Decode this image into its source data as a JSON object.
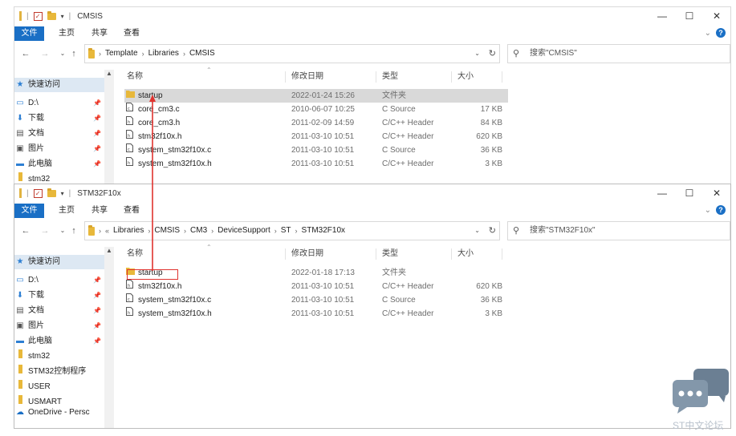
{
  "windows": [
    {
      "title": "CMSIS",
      "ribbon_tabs": [
        "文件",
        "主页",
        "共享",
        "查看"
      ],
      "breadcrumb": [
        "Template",
        "Libraries",
        "CMSIS"
      ],
      "breadcrumb_prefix": "",
      "search_placeholder": "搜索\"CMSIS\"",
      "columns": [
        "名称",
        "修改日期",
        "类型",
        "大小"
      ],
      "files": [
        {
          "name": "startup",
          "date": "2022-01-24 15:26",
          "type": "文件夹",
          "size": "",
          "icon": "folder-icon",
          "selected": true
        },
        {
          "name": "core_cm3.c",
          "date": "2010-06-07 10:25",
          "type": "C Source",
          "size": "17 KB",
          "icon": "c-source-file-icon",
          "selected": false
        },
        {
          "name": "core_cm3.h",
          "date": "2011-02-09 14:59",
          "type": "C/C++ Header",
          "size": "84 KB",
          "icon": "header-file-icon",
          "selected": false
        },
        {
          "name": "stm32f10x.h",
          "date": "2011-03-10 10:51",
          "type": "C/C++ Header",
          "size": "620 KB",
          "icon": "header-file-icon",
          "selected": false
        },
        {
          "name": "system_stm32f10x.c",
          "date": "2011-03-10 10:51",
          "type": "C Source",
          "size": "36 KB",
          "icon": "c-source-file-icon",
          "selected": false
        },
        {
          "name": "system_stm32f10x.h",
          "date": "2011-03-10 10:51",
          "type": "C/C++ Header",
          "size": "3 KB",
          "icon": "header-file-icon",
          "selected": false
        }
      ],
      "nav": [
        {
          "label": "快速访问",
          "icon": "star-icon",
          "pinned": false,
          "selected": true
        },
        {
          "label": "D:\\",
          "icon": "drive-icon",
          "pinned": true,
          "selected": false
        },
        {
          "label": "下载",
          "icon": "download-icon",
          "pinned": true,
          "selected": false
        },
        {
          "label": "文档",
          "icon": "document-icon",
          "pinned": true,
          "selected": false
        },
        {
          "label": "图片",
          "icon": "picture-icon",
          "pinned": true,
          "selected": false
        },
        {
          "label": "此电脑",
          "icon": "computer-icon",
          "pinned": true,
          "selected": false
        },
        {
          "label": "stm32",
          "icon": "folder-icon",
          "pinned": false,
          "selected": false
        }
      ]
    },
    {
      "title": "STM32F10x",
      "ribbon_tabs": [
        "文件",
        "主页",
        "共享",
        "查看"
      ],
      "breadcrumb": [
        "Libraries",
        "CMSIS",
        "CM3",
        "DeviceSupport",
        "ST",
        "STM32F10x"
      ],
      "breadcrumb_prefix": "«",
      "search_placeholder": "搜索\"STM32F10x\"",
      "columns": [
        "名称",
        "修改日期",
        "类型",
        "大小"
      ],
      "files": [
        {
          "name": "startup",
          "date": "2022-01-18 17:13",
          "type": "文件夹",
          "size": "",
          "icon": "folder-icon",
          "selected": false
        },
        {
          "name": "stm32f10x.h",
          "date": "2011-03-10 10:51",
          "type": "C/C++ Header",
          "size": "620 KB",
          "icon": "header-file-icon",
          "selected": false
        },
        {
          "name": "system_stm32f10x.c",
          "date": "2011-03-10 10:51",
          "type": "C Source",
          "size": "36 KB",
          "icon": "c-source-file-icon",
          "selected": false
        },
        {
          "name": "system_stm32f10x.h",
          "date": "2011-03-10 10:51",
          "type": "C/C++ Header",
          "size": "3 KB",
          "icon": "header-file-icon",
          "selected": false
        }
      ],
      "nav": [
        {
          "label": "快速访问",
          "icon": "star-icon",
          "pinned": false,
          "selected": true
        },
        {
          "label": "D:\\",
          "icon": "drive-icon",
          "pinned": true,
          "selected": false
        },
        {
          "label": "下载",
          "icon": "download-icon",
          "pinned": true,
          "selected": false
        },
        {
          "label": "文档",
          "icon": "document-icon",
          "pinned": true,
          "selected": false
        },
        {
          "label": "图片",
          "icon": "picture-icon",
          "pinned": true,
          "selected": false
        },
        {
          "label": "此电脑",
          "icon": "computer-icon",
          "pinned": true,
          "selected": false
        },
        {
          "label": "stm32",
          "icon": "folder-icon",
          "pinned": false,
          "selected": false
        },
        {
          "label": "STM32控制程序",
          "icon": "folder-icon",
          "pinned": false,
          "selected": false
        },
        {
          "label": "USER",
          "icon": "folder-icon",
          "pinned": false,
          "selected": false
        },
        {
          "label": "USMART",
          "icon": "folder-icon",
          "pinned": false,
          "selected": false
        },
        {
          "label": "OneDrive - Persc",
          "icon": "cloud-icon",
          "pinned": false,
          "selected": false
        }
      ]
    }
  ],
  "watermark": {
    "text": "ST中文论坛"
  },
  "colors": {
    "accent": "#1a6fc5",
    "highlight": "#e0332f",
    "selected_row": "#d9d9d9"
  }
}
